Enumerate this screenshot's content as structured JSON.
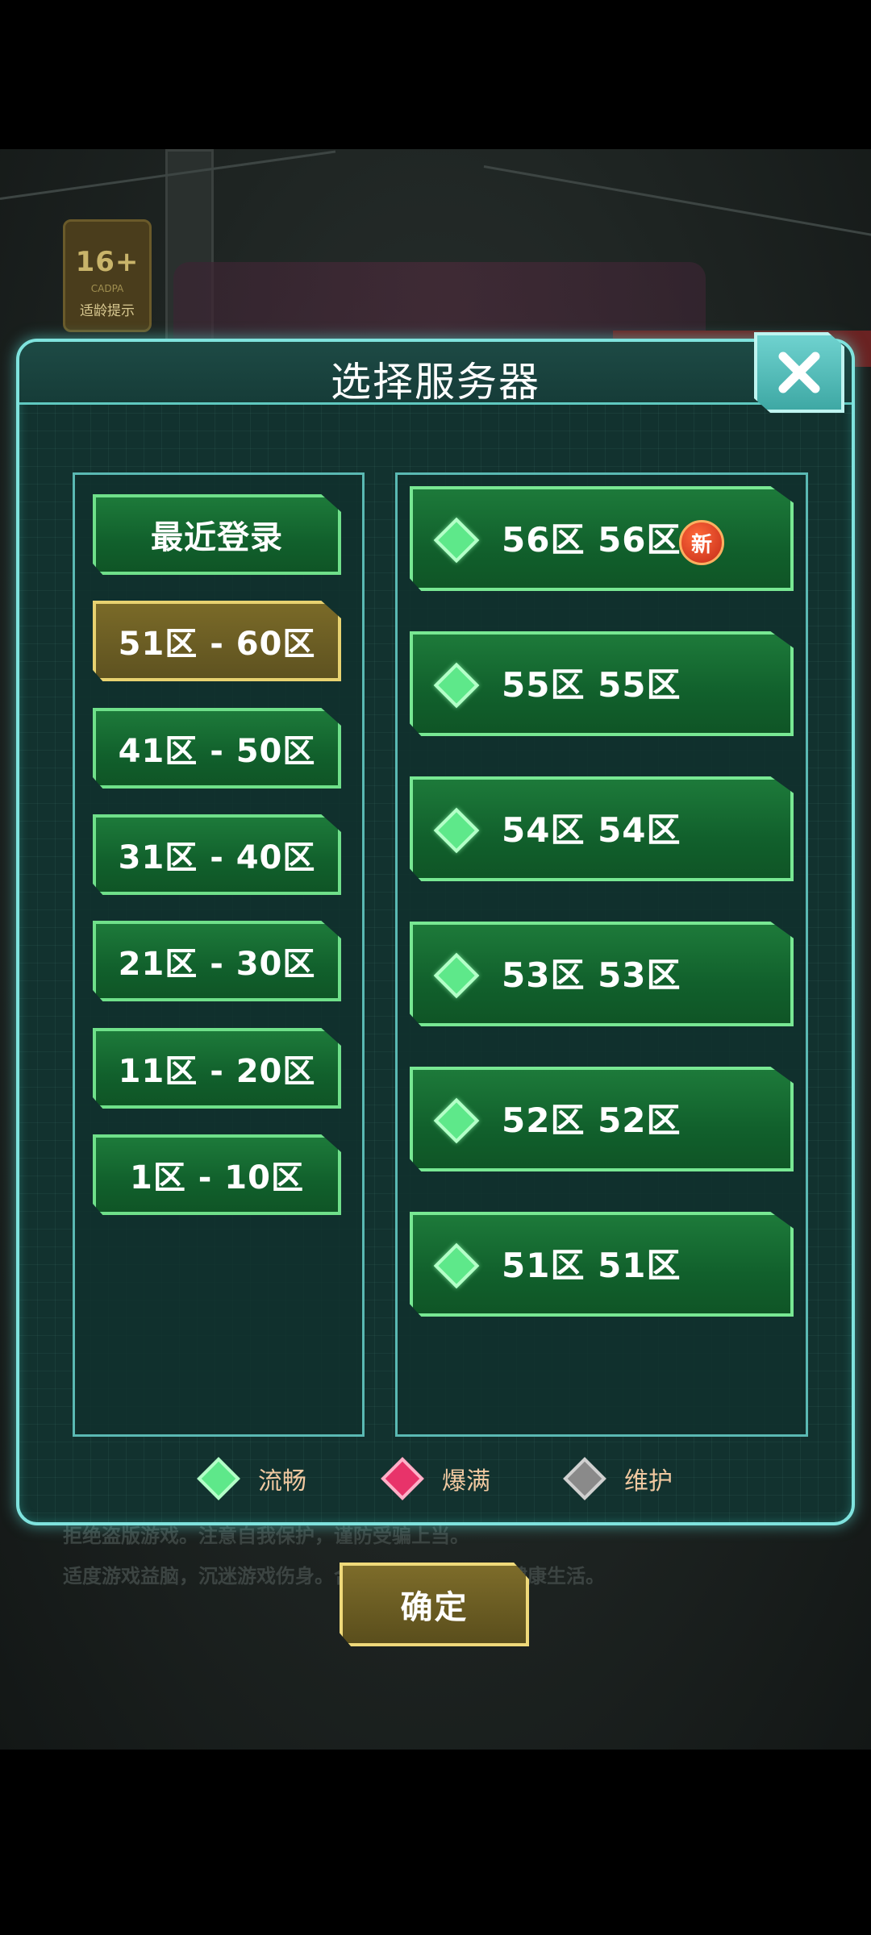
{
  "age_rating": {
    "age": "16+",
    "org": "CADPA",
    "tip": "适龄提示"
  },
  "dialog": {
    "title": "选择服务器"
  },
  "range_tabs": [
    {
      "label": "最近登录",
      "active": false
    },
    {
      "label": "51区 - 60区",
      "active": true
    },
    {
      "label": "41区 - 50区",
      "active": false
    },
    {
      "label": "31区 - 40区",
      "active": false
    },
    {
      "label": "21区 - 30区",
      "active": false
    },
    {
      "label": "11区 - 20区",
      "active": false
    },
    {
      "label": "1区 - 10区",
      "active": false
    }
  ],
  "servers": [
    {
      "label": "56区 56区",
      "status": "流畅",
      "is_new": true,
      "badge": "新"
    },
    {
      "label": "55区 55区",
      "status": "流畅",
      "is_new": false
    },
    {
      "label": "54区 54区",
      "status": "流畅",
      "is_new": false
    },
    {
      "label": "53区 53区",
      "status": "流畅",
      "is_new": false
    },
    {
      "label": "52区 52区",
      "status": "流畅",
      "is_new": false
    },
    {
      "label": "51区 51区",
      "status": "流畅",
      "is_new": false
    }
  ],
  "legend": [
    {
      "label": "流畅",
      "color": "#5ee88a"
    },
    {
      "label": "爆满",
      "color": "#e8336a"
    },
    {
      "label": "维护",
      "color": "#8a8a8a"
    }
  ],
  "background_notice": {
    "line1": "拒绝盗版游戏。注意自我保护，谨防受骗上当。",
    "line2": "适度游戏益脑，沉迷游戏伤身。合理安排时间，享受健康生活。"
  },
  "confirm_label": "确定"
}
